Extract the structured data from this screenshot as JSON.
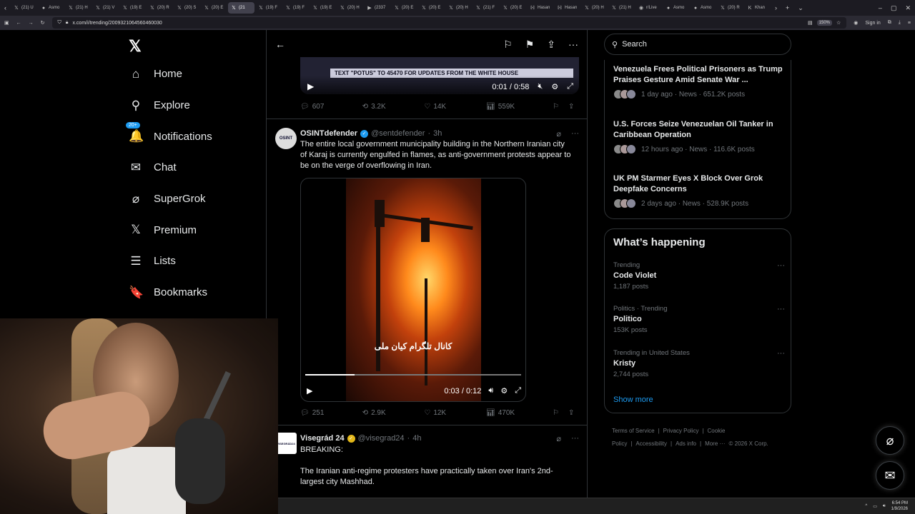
{
  "browser": {
    "tabs": [
      {
        "icon": "x",
        "label": "(21) U"
      },
      {
        "icon": "asmon",
        "label": "Asmo"
      },
      {
        "icon": "x",
        "label": "(21) H"
      },
      {
        "icon": "x",
        "label": "(21) V"
      },
      {
        "icon": "x",
        "label": "(19) E"
      },
      {
        "icon": "x",
        "label": "(20) R"
      },
      {
        "icon": "x",
        "label": "(20) S"
      },
      {
        "icon": "x",
        "label": "(20) E"
      },
      {
        "icon": "x",
        "label": "(21"
      },
      {
        "icon": "x",
        "label": "(19) F"
      },
      {
        "icon": "x",
        "label": "(19) F"
      },
      {
        "icon": "x",
        "label": "(19) E"
      },
      {
        "icon": "x",
        "label": "(20) H"
      },
      {
        "icon": "yt",
        "label": "(2337"
      },
      {
        "icon": "x",
        "label": "(20) E"
      },
      {
        "icon": "x",
        "label": "(20) E"
      },
      {
        "icon": "x",
        "label": "(20) H"
      },
      {
        "icon": "x",
        "label": "(21) F"
      },
      {
        "icon": "x",
        "label": "(20) E"
      },
      {
        "icon": "hasan",
        "label": "Hasan"
      },
      {
        "icon": "hasan",
        "label": "Hasan"
      },
      {
        "icon": "x",
        "label": "(20) H"
      },
      {
        "icon": "x",
        "label": "(21) H"
      },
      {
        "icon": "reddit",
        "label": "r/Live"
      },
      {
        "icon": "asmon",
        "label": "Asmo"
      },
      {
        "icon": "asmon",
        "label": "Asmo"
      },
      {
        "icon": "x",
        "label": "(20) R"
      },
      {
        "icon": "khan",
        "label": "Khan"
      }
    ],
    "active_tab": 8,
    "url": "x.com/i/trending/2009321064560460030",
    "zoom": "150%",
    "signin": "Sign in"
  },
  "nav": {
    "logo": "𝕏",
    "items": [
      {
        "icon": "⌂",
        "label": "Home"
      },
      {
        "icon": "⚲",
        "label": "Explore"
      },
      {
        "icon": "🔔",
        "label": "Notifications",
        "badge": "20+"
      },
      {
        "icon": "✉",
        "label": "Chat"
      },
      {
        "icon": "⌀",
        "label": "SuperGrok"
      },
      {
        "icon": "𝕏",
        "label": "Premium"
      },
      {
        "icon": "☰",
        "label": "Lists"
      },
      {
        "icon": "🔖",
        "label": "Bookmarks"
      }
    ]
  },
  "top_video": {
    "banner": "TEXT \"POTUS\" TO 45470 FOR UPDATES FROM THE WHITE HOUSE",
    "time": "0:01 / 0:58",
    "stats": {
      "replies": "607",
      "reposts": "3.2K",
      "likes": "14K",
      "views": "559K"
    }
  },
  "posts": [
    {
      "name": "OSINTdefender",
      "handle": "@sentdefender",
      "time": "3h",
      "avatar": "OSINT",
      "text": "The entire local government municipality building in the Northern Iranian city of Karaj is currently engulfed in flames, as anti-government protests appear to be on the verge of overflowing in Iran.",
      "video": {
        "subtitle": "كانال تلگرام كيان ملى",
        "time": "0:03 / 0:12",
        "progress": 0.23
      },
      "stats": {
        "replies": "251",
        "reposts": "2.9K",
        "likes": "12K",
        "views": "470K"
      }
    },
    {
      "name": "Visegrád 24",
      "handle": "@visegrad24",
      "time": "4h",
      "avatar": "VISEGRÁD24",
      "text1": "BREAKING:",
      "text2": "The Iranian anti-regime protesters have practically taken over Iran's 2nd-largest city Mashhad."
    }
  ],
  "right": {
    "search_placeholder": "Search",
    "news": [
      {
        "title": "Venezuela Frees Political Prisoners as Trump Praises Gesture Amid Senate War ...",
        "meta": "1 day ago · News · 651.2K posts"
      },
      {
        "title": "U.S. Forces Seize Venezuelan Oil Tanker in Caribbean Operation",
        "meta": "12 hours ago · News · 116.6K posts"
      },
      {
        "title": "UK PM Starmer Eyes X Block Over Grok Deepfake Concerns",
        "meta": "2 days ago · News · 528.9K posts"
      }
    ],
    "happening_title": "What’s happening",
    "trends": [
      {
        "context": "Trending",
        "name": "Code Violet",
        "posts": "1,187 posts"
      },
      {
        "context": "Politics · Trending",
        "name": "Politico",
        "posts": "153K posts"
      },
      {
        "context": "Trending in United States",
        "name": "Kristy",
        "posts": "2,744 posts"
      }
    ],
    "show_more": "Show more",
    "footer": [
      "Terms of Service",
      "|",
      "Privacy Policy",
      "|",
      "Cookie Policy",
      "|",
      "Accessibility",
      "|",
      "Ads info",
      "|",
      "More ···",
      "© 2026 X Corp."
    ]
  },
  "taskbar": {
    "time": "6:54 PM",
    "date": "1/9/2026"
  }
}
